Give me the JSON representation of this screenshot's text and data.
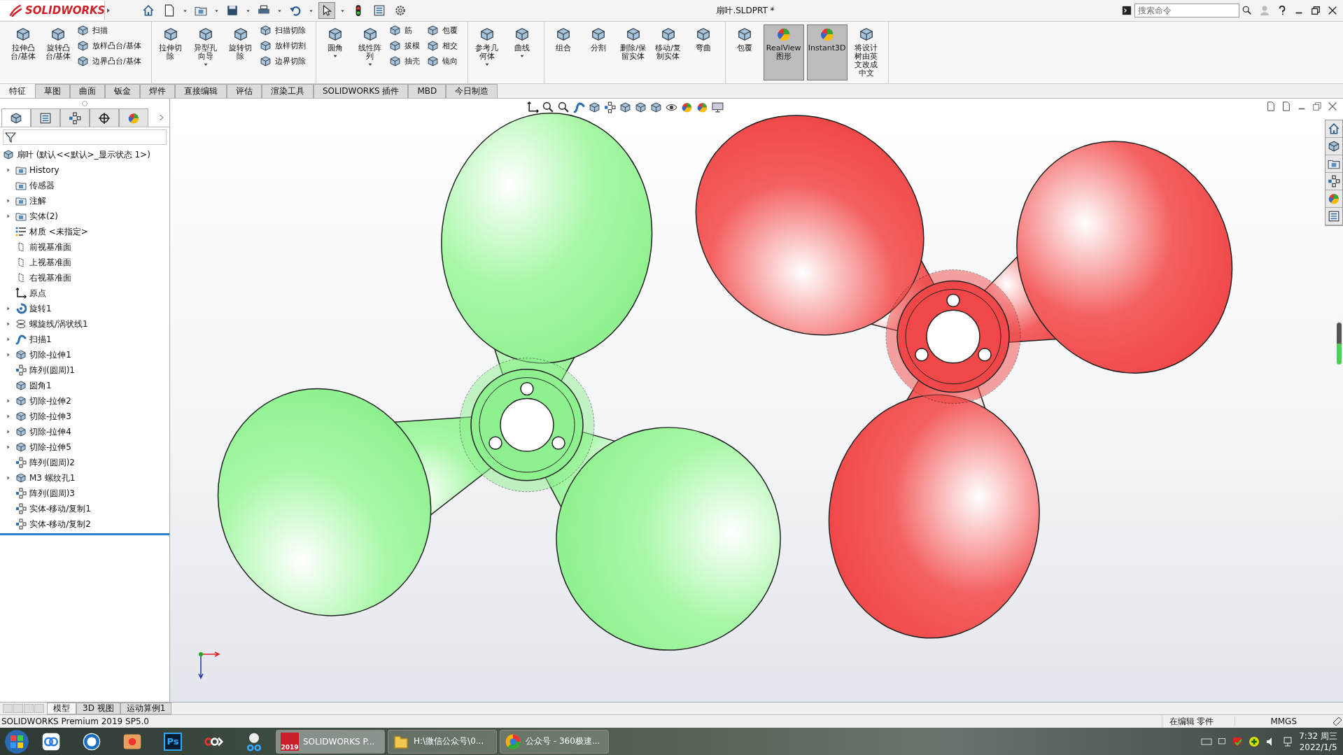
{
  "title_bar": {
    "logo": "SOLIDWORKS",
    "title": "扇叶.SLDPRT *",
    "search": {
      "placeholder": "搜索命令"
    }
  },
  "ribbon": [
    {
      "columns": [
        {
          "kind": "large",
          "label": "拉伸凸台/基体",
          "menu": false,
          "on": false
        },
        {
          "kind": "large",
          "label": "旋转凸台/基体",
          "menu": false,
          "on": false
        },
        {
          "kind": "stack",
          "items": [
            "扫描",
            "放样凸台/基体",
            "边界凸台/基体"
          ]
        }
      ]
    },
    {
      "columns": [
        {
          "kind": "large",
          "label": "拉伸切除",
          "menu": false,
          "on": false
        },
        {
          "kind": "large",
          "label": "异型孔向导",
          "menu": true,
          "on": false
        },
        {
          "kind": "large",
          "label": "旋转切除",
          "menu": false,
          "on": false
        },
        {
          "kind": "stack",
          "items": [
            "扫描切除",
            "放样切割",
            "边界切除"
          ]
        }
      ]
    },
    {
      "columns": [
        {
          "kind": "large",
          "label": "圆角",
          "menu": true,
          "on": false
        },
        {
          "kind": "large",
          "label": "线性阵列",
          "menu": true,
          "on": false
        },
        {
          "kind": "stack",
          "items": [
            "筋",
            "拔模",
            "抽壳"
          ]
        },
        {
          "kind": "stack",
          "items": [
            "包覆",
            "相交",
            "镜向"
          ]
        }
      ]
    },
    {
      "columns": [
        {
          "kind": "large",
          "label": "参考几何体",
          "menu": true,
          "on": false
        },
        {
          "kind": "large",
          "label": "曲线",
          "menu": true,
          "on": false
        }
      ]
    },
    {
      "columns": [
        {
          "kind": "large",
          "label": "组合",
          "menu": false,
          "on": false
        },
        {
          "kind": "large",
          "label": "分割",
          "menu": false,
          "on": false
        },
        {
          "kind": "large",
          "label": "删除/保留实体",
          "menu": false,
          "on": false
        },
        {
          "kind": "large",
          "label": "移动/复制实体",
          "menu": false,
          "on": false
        },
        {
          "kind": "large",
          "label": "弯曲",
          "menu": false,
          "on": false
        }
      ]
    },
    {
      "columns": [
        {
          "kind": "large",
          "label": "包覆",
          "menu": false,
          "on": false
        },
        {
          "kind": "large",
          "label": "RealView图形",
          "menu": false,
          "on": true
        },
        {
          "kind": "large",
          "label": "Instant3D",
          "menu": false,
          "on": true
        },
        {
          "kind": "large",
          "label": "将设计树由英文改成中文",
          "menu": false,
          "on": false
        }
      ]
    }
  ],
  "command_tabs": [
    {
      "label": "特征",
      "selected": true
    },
    {
      "label": "草图",
      "selected": false
    },
    {
      "label": "曲面",
      "selected": false
    },
    {
      "label": "钣金",
      "selected": false
    },
    {
      "label": "焊件",
      "selected": false
    },
    {
      "label": "直接编辑",
      "selected": false
    },
    {
      "label": "评估",
      "selected": false
    },
    {
      "label": "渲染工具",
      "selected": false
    },
    {
      "label": "SOLIDWORKS 插件",
      "selected": false
    },
    {
      "label": "MBD",
      "selected": false
    },
    {
      "label": "今日制造",
      "selected": false
    }
  ],
  "panel_tabs": [
    {
      "kind": "feature",
      "selected": true
    },
    {
      "kind": "property",
      "selected": false
    },
    {
      "kind": "config",
      "selected": false
    },
    {
      "kind": "target",
      "selected": false
    },
    {
      "kind": "appearance",
      "selected": false
    }
  ],
  "tree": {
    "root": "扇叶  (默认<<默认>_显示状态 1>)",
    "items": [
      {
        "label": "History",
        "kind": "folder",
        "expander": true
      },
      {
        "label": "传感器",
        "kind": "folder",
        "expander": false
      },
      {
        "label": "注解",
        "kind": "folder",
        "expander": true
      },
      {
        "label": "实体(2)",
        "kind": "folder",
        "expander": true
      },
      {
        "label": "材质 <未指定>",
        "kind": "material",
        "expander": false
      },
      {
        "label": "前视基准面",
        "kind": "plane",
        "expander": false
      },
      {
        "label": "上视基准面",
        "kind": "plane",
        "expander": false
      },
      {
        "label": "右视基准面",
        "kind": "plane",
        "expander": false
      },
      {
        "label": "原点",
        "kind": "origin",
        "expander": false
      },
      {
        "label": "旋转1",
        "kind": "revolve",
        "expander": true
      },
      {
        "label": "螺旋线/涡状线1",
        "kind": "helix",
        "expander": true
      },
      {
        "label": "扫描1",
        "kind": "sweep",
        "expander": true
      },
      {
        "label": "切除-拉伸1",
        "kind": "cut",
        "expander": true
      },
      {
        "label": "阵列(圆周)1",
        "kind": "pattern",
        "expander": false
      },
      {
        "label": "圆角1",
        "kind": "fillet",
        "expander": false
      },
      {
        "label": "切除-拉伸2",
        "kind": "cut",
        "expander": true
      },
      {
        "label": "切除-拉伸3",
        "kind": "cut",
        "expander": true
      },
      {
        "label": "切除-拉伸4",
        "kind": "cut",
        "expander": true
      },
      {
        "label": "切除-拉伸5",
        "kind": "cut",
        "expander": true
      },
      {
        "label": "阵列(圆周)2",
        "kind": "pattern",
        "expander": false
      },
      {
        "label": "M3 螺纹孔1",
        "kind": "hole",
        "expander": true
      },
      {
        "label": "阵列(圆周)3",
        "kind": "pattern",
        "expander": false
      },
      {
        "label": "实体-移动/复制1",
        "kind": "move",
        "expander": false
      },
      {
        "label": "实体-移动/复制2",
        "kind": "move",
        "expander": false
      }
    ]
  },
  "model_tabs": [
    {
      "label": "模型",
      "selected": true
    },
    {
      "label": "3D 视图",
      "selected": false
    },
    {
      "label": "运动算例1",
      "selected": false
    }
  ],
  "status_bar": {
    "product": "SOLIDWORKS Premium 2019 SP5.0",
    "mode": "在编辑 零件",
    "units": "MMGS"
  },
  "taskbar": {
    "pinned": [
      {
        "kind": "cloud"
      },
      {
        "kind": "aperture"
      },
      {
        "kind": "photos"
      },
      {
        "kind": "ps",
        "label": "Ps"
      },
      {
        "kind": "video"
      },
      {
        "kind": "scissors"
      }
    ],
    "windows": [
      {
        "kind": "solidworks",
        "badge": "2019",
        "label": "SOLIDWORKS P...",
        "selected": true
      },
      {
        "kind": "folder",
        "label": "H:\\微信公众号\\0...",
        "selected": false
      },
      {
        "kind": "browser",
        "label": "公众号 - 360极速...",
        "selected": false
      }
    ],
    "clock": {
      "time": "7:32 周三",
      "date": "2022/1/5"
    }
  }
}
